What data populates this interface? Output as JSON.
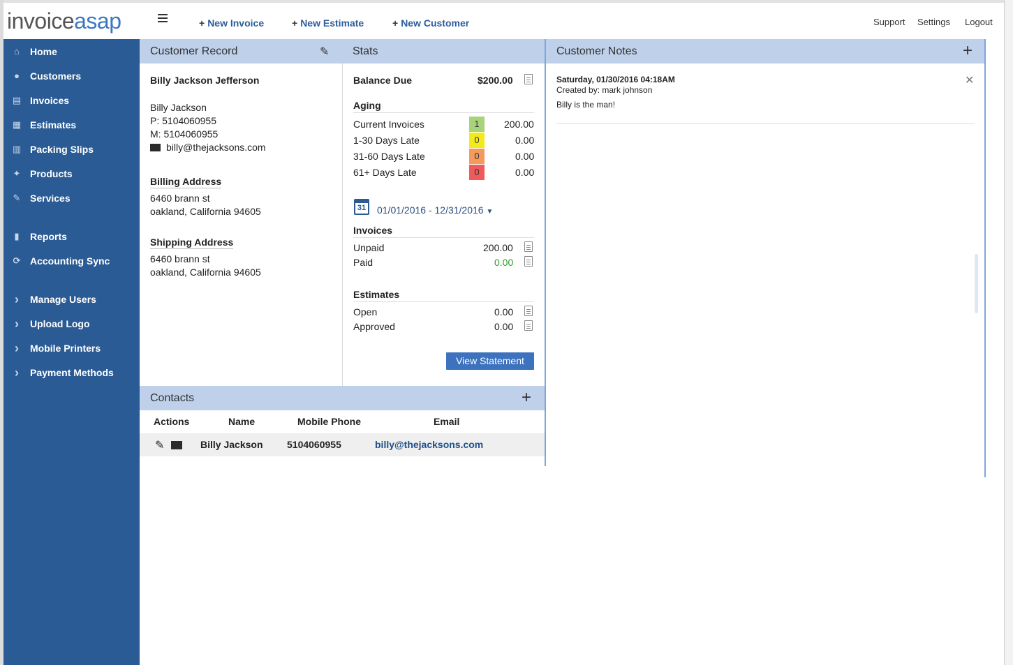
{
  "brand": {
    "part1": "invoice",
    "part2": "asap"
  },
  "topbar": {
    "quick_actions": [
      "New Invoice",
      "New Estimate",
      "New Customer"
    ],
    "links": [
      "Support",
      "Settings",
      "Logout"
    ]
  },
  "sidebar": {
    "items": [
      {
        "label": "Home",
        "icon": "home-icon",
        "glyph": "⌂"
      },
      {
        "label": "Customers",
        "icon": "user-icon",
        "glyph": "●"
      },
      {
        "label": "Invoices",
        "icon": "invoice-icon",
        "glyph": "▤"
      },
      {
        "label": "Estimates",
        "icon": "estimates-icon",
        "glyph": "▦"
      },
      {
        "label": "Packing Slips",
        "icon": "packing-slips-icon",
        "glyph": "▥"
      },
      {
        "label": "Products",
        "icon": "products-icon",
        "glyph": "✦"
      },
      {
        "label": "Services",
        "icon": "wrench-icon",
        "glyph": "✎"
      },
      {
        "label": "Reports",
        "icon": "bar-chart-icon",
        "glyph": "▮"
      },
      {
        "label": "Accounting Sync",
        "icon": "sync-icon",
        "glyph": "⟳"
      },
      {
        "label": "Manage Users",
        "icon": "chevron-right-icon",
        "glyph": "›"
      },
      {
        "label": "Upload Logo",
        "icon": "chevron-right-icon",
        "glyph": "›"
      },
      {
        "label": "Mobile Printers",
        "icon": "chevron-right-icon",
        "glyph": "›"
      },
      {
        "label": "Payment Methods",
        "icon": "chevron-right-icon",
        "glyph": "›"
      }
    ]
  },
  "customer_record": {
    "title": "Customer Record",
    "name": "Billy Jackson Jefferson",
    "contact_name": "Billy Jackson",
    "phone": "P: 5104060955",
    "mobile": "M: 5104060955",
    "email": "billy@thejacksons.com",
    "billing_heading": "Billing Address",
    "billing_line1": "6460 brann st",
    "billing_line2": "oakland, California 94605",
    "shipping_heading": "Shipping Address",
    "shipping_line1": "6460 brann st",
    "shipping_line2": "oakland, California 94605"
  },
  "stats": {
    "title": "Stats",
    "balance_label": "Balance Due",
    "balance_value": "$200.00",
    "aging_heading": "Aging",
    "aging": [
      {
        "label": "Current Invoices",
        "count": "1",
        "amount": "200.00",
        "color": "#a8d37a"
      },
      {
        "label": "1-30 Days Late",
        "count": "0",
        "amount": "0.00",
        "color": "#f2ea1a"
      },
      {
        "label": "31-60 Days Late",
        "count": "0",
        "amount": "0.00",
        "color": "#f49a5c"
      },
      {
        "label": "61+ Days Late",
        "count": "0",
        "amount": "0.00",
        "color": "#ef5b5b"
      }
    ],
    "date_range": "01/01/2016 - 12/31/2016",
    "calendar_day": "31",
    "invoices_heading": "Invoices",
    "unpaid_label": "Unpaid",
    "unpaid_value": "200.00",
    "paid_label": "Paid",
    "paid_value": "0.00",
    "estimates_heading": "Estimates",
    "open_label": "Open",
    "open_value": "0.00",
    "approved_label": "Approved",
    "approved_value": "0.00",
    "view_statement": "View Statement"
  },
  "notes": {
    "title": "Customer Notes",
    "date": "Saturday, 01/30/2016 04:18AM",
    "created_by": "Created by: mark johnson",
    "body": "Billy is the man!"
  },
  "contacts": {
    "title": "Contacts",
    "columns": [
      "Actions",
      "Name",
      "Mobile Phone",
      "Email"
    ],
    "rows": [
      {
        "name": "Billy Jackson",
        "mobile": "5104060955",
        "email": "billy@thejacksons.com"
      }
    ]
  },
  "colors": {
    "sidebar": "#2a5b94",
    "panel_header": "#bed0ea",
    "accent": "#3c72be",
    "paid_green": "#2a9a2a"
  }
}
